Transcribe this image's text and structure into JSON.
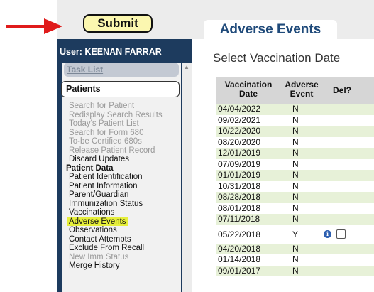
{
  "header": {
    "submit_label": "Submit",
    "tab_label": "Adverse Events"
  },
  "sidebar": {
    "user_label": "User: KEENAN FARRAR",
    "task_list_label": "Task List",
    "patients_label": "Patients",
    "patient_data_header": "Patient Data",
    "items_a": [
      {
        "label": "Search for Patient",
        "state": "disabled"
      },
      {
        "label": "Redisplay Search Results",
        "state": "disabled"
      },
      {
        "label": "Today's Patient List",
        "state": "disabled"
      },
      {
        "label": "Search for Form 680",
        "state": "disabled"
      },
      {
        "label": "To-be Certified 680s",
        "state": "disabled"
      },
      {
        "label": "Release Patient Record",
        "state": "disabled"
      },
      {
        "label": "Discard Updates",
        "state": "enabled"
      }
    ],
    "items_b": [
      {
        "label": "Patient Identification",
        "state": "enabled"
      },
      {
        "label": "Patient Information",
        "state": "enabled"
      },
      {
        "label": "Parent/Guardian",
        "state": "enabled"
      },
      {
        "label": "Immunization Status",
        "state": "enabled"
      },
      {
        "label": "Vaccinations",
        "state": "enabled"
      },
      {
        "label": "Adverse Events",
        "state": "selected"
      },
      {
        "label": "Observations",
        "state": "enabled"
      },
      {
        "label": "Contact Attempts",
        "state": "enabled"
      },
      {
        "label": "Exclude From Recall",
        "state": "enabled"
      },
      {
        "label": "New Imm Status",
        "state": "disabled"
      },
      {
        "label": "Merge History",
        "state": "enabled"
      }
    ]
  },
  "main": {
    "section_title": "Select Vaccination Date",
    "columns": {
      "date_line1": "Vaccination",
      "date_line2": "Date",
      "ae_line1": "Adverse",
      "ae_line2": "Event",
      "del": "Del?"
    },
    "rows": [
      {
        "date": "04/04/2022",
        "ae": "N"
      },
      {
        "date": "09/02/2021",
        "ae": "N"
      },
      {
        "date": "10/22/2020",
        "ae": "N"
      },
      {
        "date": "08/20/2020",
        "ae": "N"
      },
      {
        "date": "12/01/2019",
        "ae": "N"
      },
      {
        "date": "07/09/2019",
        "ae": "N"
      },
      {
        "date": "01/01/2019",
        "ae": "N"
      },
      {
        "date": "10/31/2018",
        "ae": "N"
      },
      {
        "date": "08/28/2018",
        "ae": "N"
      },
      {
        "date": "08/01/2018",
        "ae": "N"
      },
      {
        "date": "07/11/2018",
        "ae": "N"
      },
      {
        "date": "05/22/2018",
        "ae": "Y",
        "has_info": true,
        "has_delete": true
      },
      {
        "date": "04/20/2018",
        "ae": "N"
      },
      {
        "date": "01/14/2018",
        "ae": "N"
      },
      {
        "date": "09/01/2017",
        "ae": "N"
      }
    ]
  },
  "icons": {
    "info_glyph": "i",
    "scroll_up_glyph": "▲"
  },
  "colors": {
    "sidebar_bg": "#1d3b5e",
    "tab_text": "#1f4a7a",
    "selected_highlight": "#e6ef3a",
    "row_alt": "#e7f1d8",
    "submit_bg": "#fbf7b0",
    "arrow": "#e01b1b"
  }
}
